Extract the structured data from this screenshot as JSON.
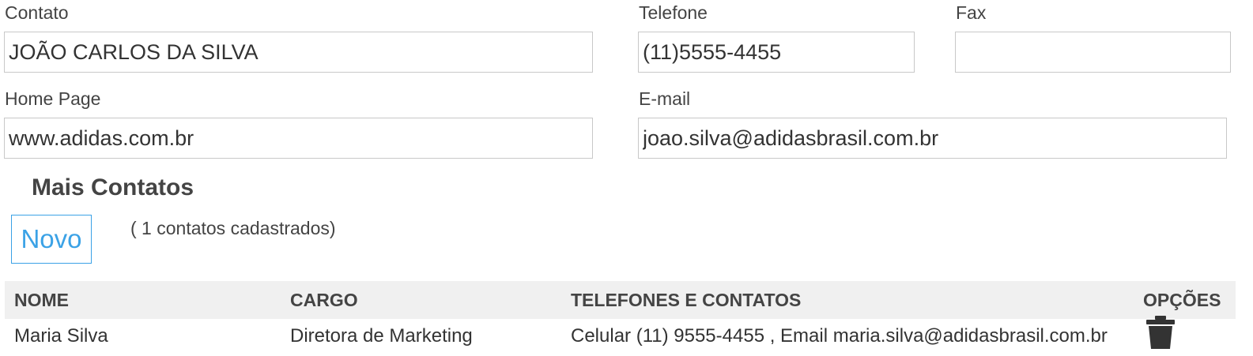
{
  "form": {
    "contato": {
      "label": "Contato",
      "value": "JOÃO CARLOS DA SILVA"
    },
    "telefone": {
      "label": "Telefone",
      "value": "(11)5555-4455"
    },
    "fax": {
      "label": "Fax",
      "value": ""
    },
    "homepage": {
      "label": "Home Page",
      "value": "www.adidas.com.br"
    },
    "email": {
      "label": "E-mail",
      "value": "joao.silva@adidasbrasil.com.br"
    }
  },
  "mais_contatos": {
    "title": "Mais Contatos",
    "new_button": "Novo",
    "count_text": "( 1  contatos cadastrados)"
  },
  "table": {
    "headers": {
      "nome": "NOME",
      "cargo": "CARGO",
      "telefones": "TELEFONES E CONTATOS",
      "opcoes": "OPÇÕES"
    },
    "rows": [
      {
        "nome": "Maria Silva",
        "cargo": "Diretora de Marketing",
        "telefones": "Celular (11) 9555-4455 , Email maria.silva@adidasbrasil.com.br",
        "delete_icon": "trash-icon"
      }
    ]
  },
  "colors": {
    "accent": "#3ba2e6",
    "header_bg": "#f0f0f0",
    "border": "#c8c8c8",
    "text": "#444444"
  }
}
